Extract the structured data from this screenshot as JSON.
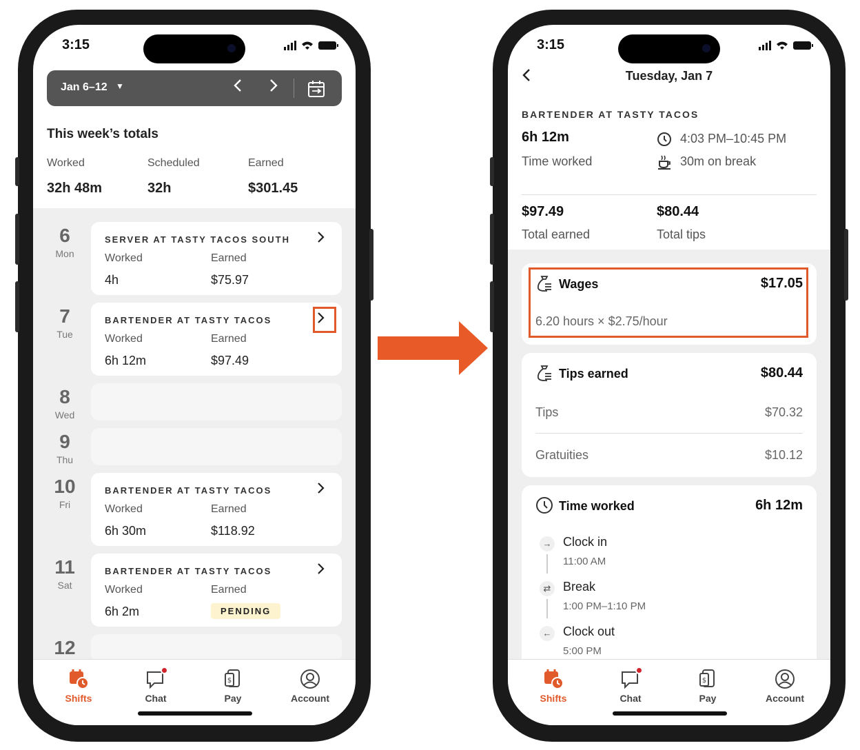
{
  "colors": {
    "accent": "#e05a2b",
    "bar": "#555555",
    "bg_gray": "#efefef",
    "pending": "#fdf3cf"
  },
  "left": {
    "status_time": "3:15",
    "week_range": "Jan 6–12",
    "totals_title": "This week’s totals",
    "totals": [
      {
        "label": "Worked",
        "value": "32h 48m"
      },
      {
        "label": "Scheduled",
        "value": "32h"
      },
      {
        "label": "Earned",
        "value": "$301.45"
      }
    ],
    "days": [
      {
        "num": "6",
        "name": "Mon",
        "role": "SERVER AT TASTY TACOS SOUTH",
        "worked_label": "Worked",
        "worked": "4h",
        "earned_label": "Earned",
        "earned": "$75.97"
      },
      {
        "num": "7",
        "name": "Tue",
        "role": "BARTENDER AT TASTY TACOS",
        "worked_label": "Worked",
        "worked": "6h 12m",
        "earned_label": "Earned",
        "earned": "$97.49"
      },
      {
        "num": "8",
        "name": "Wed"
      },
      {
        "num": "9",
        "name": "Thu"
      },
      {
        "num": "10",
        "name": "Fri",
        "role": "BARTENDER AT TASTY TACOS",
        "worked_label": "Worked",
        "worked": "6h 30m",
        "earned_label": "Earned",
        "earned": "$118.92"
      },
      {
        "num": "11",
        "name": "Sat",
        "role": "BARTENDER AT TASTY TACOS",
        "worked_label": "Worked",
        "worked": "6h 2m",
        "earned_label": "Earned",
        "pending": "PENDING"
      },
      {
        "num": "12"
      }
    ]
  },
  "tabs": [
    {
      "label": "Shifts",
      "icon": "calendar-clock-icon"
    },
    {
      "label": "Chat",
      "icon": "chat-bubble-icon"
    },
    {
      "label": "Pay",
      "icon": "pay-phone-icon"
    },
    {
      "label": "Account",
      "icon": "account-icon"
    }
  ],
  "right": {
    "status_time": "3:15",
    "title": "Tuesday, Jan 7",
    "role": "BARTENDER AT TASTY TACOS",
    "time_worked_value": "6h 12m",
    "time_worked_label": "Time worked",
    "time_range": "4:03 PM–10:45 PM",
    "break_text": "30m on break",
    "total_earned_value": "$97.49",
    "total_earned_label": "Total earned",
    "total_tips_value": "$80.44",
    "total_tips_label": "Total tips",
    "wages": {
      "title": "Wages",
      "amount": "$17.05",
      "detail": "6.20 hours × $2.75/hour"
    },
    "tips": {
      "title": "Tips earned",
      "amount": "$80.44",
      "rows": [
        {
          "label": "Tips",
          "value": "$70.32"
        },
        {
          "label": "Gratuities",
          "value": "$10.12"
        }
      ]
    },
    "timeworked": {
      "title": "Time worked",
      "amount": "6h 12m",
      "events": [
        {
          "title": "Clock in",
          "time": "11:00 AM"
        },
        {
          "title": "Break",
          "time": "1:00 PM–1:10 PM"
        },
        {
          "title": "Clock out",
          "time": "5:00 PM"
        }
      ]
    }
  }
}
